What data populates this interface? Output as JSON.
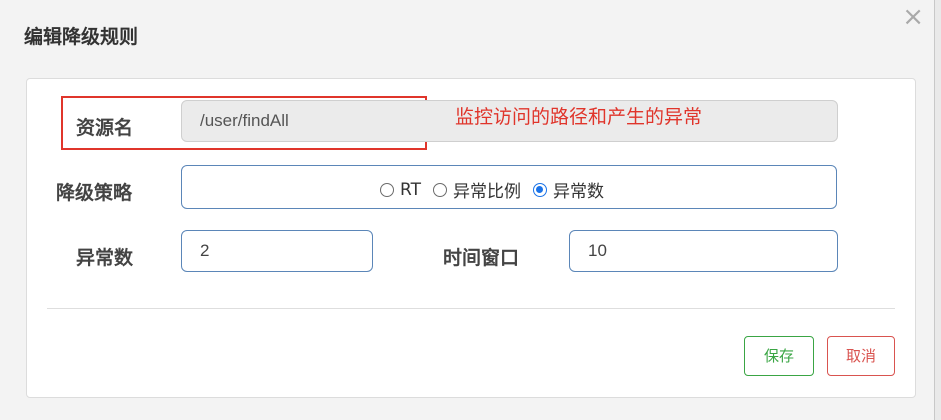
{
  "dialog": {
    "title": "编辑降级规则",
    "close_label": "×"
  },
  "form": {
    "resource": {
      "label": "资源名",
      "value": "/user/findAll"
    },
    "annotation": "监控访问的路径和产生的异常",
    "strategy": {
      "label": "降级策略",
      "options": [
        {
          "label": "RT",
          "checked": false
        },
        {
          "label": "异常比例",
          "checked": false
        },
        {
          "label": "异常数",
          "checked": true
        }
      ]
    },
    "exception_count": {
      "label": "异常数",
      "value": "2"
    },
    "time_window": {
      "label": "时间窗口",
      "value": "10"
    }
  },
  "footer": {
    "save_label": "保存",
    "cancel_label": "取消"
  },
  "colors": {
    "annotation_red": "#e0352b",
    "save_green": "#3aa544",
    "cancel_red": "#d9534f",
    "radio_blue": "#1a73e8"
  }
}
